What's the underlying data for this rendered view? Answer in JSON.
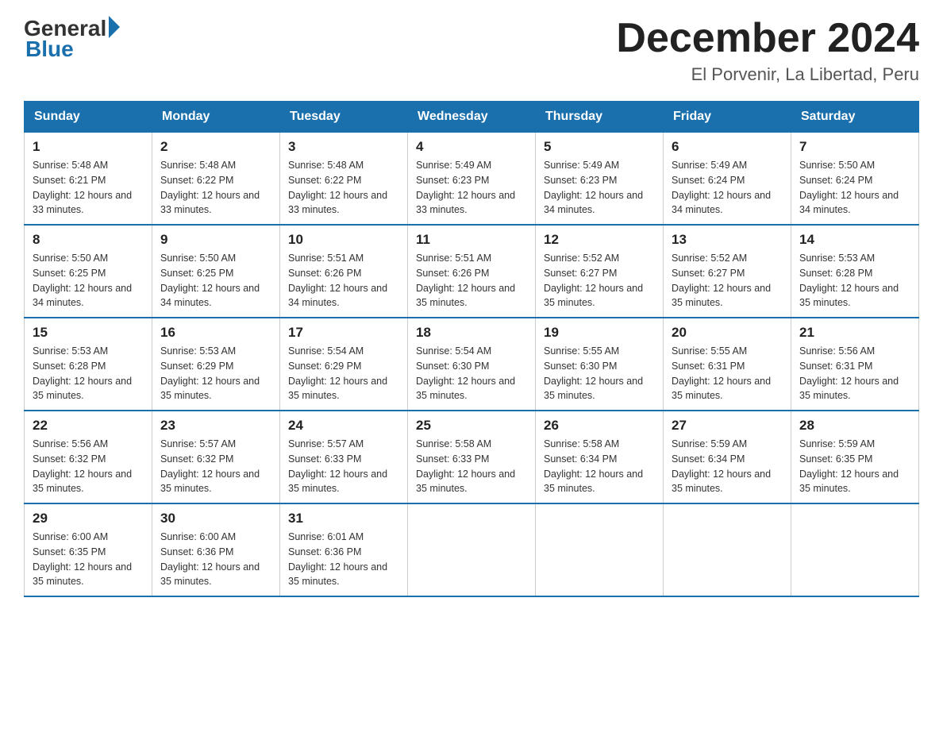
{
  "logo": {
    "general": "General",
    "blue": "Blue"
  },
  "title": "December 2024",
  "location": "El Porvenir, La Libertad, Peru",
  "days_of_week": [
    "Sunday",
    "Monday",
    "Tuesday",
    "Wednesday",
    "Thursday",
    "Friday",
    "Saturday"
  ],
  "weeks": [
    [
      {
        "day": "1",
        "sunrise": "5:48 AM",
        "sunset": "6:21 PM",
        "daylight": "12 hours and 33 minutes."
      },
      {
        "day": "2",
        "sunrise": "5:48 AM",
        "sunset": "6:22 PM",
        "daylight": "12 hours and 33 minutes."
      },
      {
        "day": "3",
        "sunrise": "5:48 AM",
        "sunset": "6:22 PM",
        "daylight": "12 hours and 33 minutes."
      },
      {
        "day": "4",
        "sunrise": "5:49 AM",
        "sunset": "6:23 PM",
        "daylight": "12 hours and 33 minutes."
      },
      {
        "day": "5",
        "sunrise": "5:49 AM",
        "sunset": "6:23 PM",
        "daylight": "12 hours and 34 minutes."
      },
      {
        "day": "6",
        "sunrise": "5:49 AM",
        "sunset": "6:24 PM",
        "daylight": "12 hours and 34 minutes."
      },
      {
        "day": "7",
        "sunrise": "5:50 AM",
        "sunset": "6:24 PM",
        "daylight": "12 hours and 34 minutes."
      }
    ],
    [
      {
        "day": "8",
        "sunrise": "5:50 AM",
        "sunset": "6:25 PM",
        "daylight": "12 hours and 34 minutes."
      },
      {
        "day": "9",
        "sunrise": "5:50 AM",
        "sunset": "6:25 PM",
        "daylight": "12 hours and 34 minutes."
      },
      {
        "day": "10",
        "sunrise": "5:51 AM",
        "sunset": "6:26 PM",
        "daylight": "12 hours and 34 minutes."
      },
      {
        "day": "11",
        "sunrise": "5:51 AM",
        "sunset": "6:26 PM",
        "daylight": "12 hours and 35 minutes."
      },
      {
        "day": "12",
        "sunrise": "5:52 AM",
        "sunset": "6:27 PM",
        "daylight": "12 hours and 35 minutes."
      },
      {
        "day": "13",
        "sunrise": "5:52 AM",
        "sunset": "6:27 PM",
        "daylight": "12 hours and 35 minutes."
      },
      {
        "day": "14",
        "sunrise": "5:53 AM",
        "sunset": "6:28 PM",
        "daylight": "12 hours and 35 minutes."
      }
    ],
    [
      {
        "day": "15",
        "sunrise": "5:53 AM",
        "sunset": "6:28 PM",
        "daylight": "12 hours and 35 minutes."
      },
      {
        "day": "16",
        "sunrise": "5:53 AM",
        "sunset": "6:29 PM",
        "daylight": "12 hours and 35 minutes."
      },
      {
        "day": "17",
        "sunrise": "5:54 AM",
        "sunset": "6:29 PM",
        "daylight": "12 hours and 35 minutes."
      },
      {
        "day": "18",
        "sunrise": "5:54 AM",
        "sunset": "6:30 PM",
        "daylight": "12 hours and 35 minutes."
      },
      {
        "day": "19",
        "sunrise": "5:55 AM",
        "sunset": "6:30 PM",
        "daylight": "12 hours and 35 minutes."
      },
      {
        "day": "20",
        "sunrise": "5:55 AM",
        "sunset": "6:31 PM",
        "daylight": "12 hours and 35 minutes."
      },
      {
        "day": "21",
        "sunrise": "5:56 AM",
        "sunset": "6:31 PM",
        "daylight": "12 hours and 35 minutes."
      }
    ],
    [
      {
        "day": "22",
        "sunrise": "5:56 AM",
        "sunset": "6:32 PM",
        "daylight": "12 hours and 35 minutes."
      },
      {
        "day": "23",
        "sunrise": "5:57 AM",
        "sunset": "6:32 PM",
        "daylight": "12 hours and 35 minutes."
      },
      {
        "day": "24",
        "sunrise": "5:57 AM",
        "sunset": "6:33 PM",
        "daylight": "12 hours and 35 minutes."
      },
      {
        "day": "25",
        "sunrise": "5:58 AM",
        "sunset": "6:33 PM",
        "daylight": "12 hours and 35 minutes."
      },
      {
        "day": "26",
        "sunrise": "5:58 AM",
        "sunset": "6:34 PM",
        "daylight": "12 hours and 35 minutes."
      },
      {
        "day": "27",
        "sunrise": "5:59 AM",
        "sunset": "6:34 PM",
        "daylight": "12 hours and 35 minutes."
      },
      {
        "day": "28",
        "sunrise": "5:59 AM",
        "sunset": "6:35 PM",
        "daylight": "12 hours and 35 minutes."
      }
    ],
    [
      {
        "day": "29",
        "sunrise": "6:00 AM",
        "sunset": "6:35 PM",
        "daylight": "12 hours and 35 minutes."
      },
      {
        "day": "30",
        "sunrise": "6:00 AM",
        "sunset": "6:36 PM",
        "daylight": "12 hours and 35 minutes."
      },
      {
        "day": "31",
        "sunrise": "6:01 AM",
        "sunset": "6:36 PM",
        "daylight": "12 hours and 35 minutes."
      },
      null,
      null,
      null,
      null
    ]
  ],
  "labels": {
    "sunrise": "Sunrise:",
    "sunset": "Sunset:",
    "daylight": "Daylight:"
  }
}
